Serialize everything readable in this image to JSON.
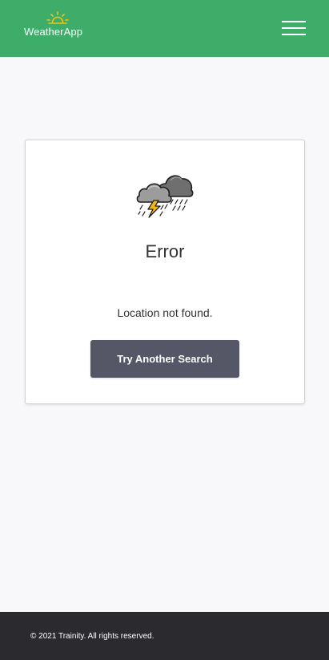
{
  "header": {
    "brand_name": "WeatherApp",
    "brand_icon": "sunrise-icon",
    "menu_icon": "hamburger-menu-icon"
  },
  "error_card": {
    "icon": "thunderstorm-icon",
    "title": "Error",
    "message": "Location not found.",
    "button_label": "Try Another Search"
  },
  "footer": {
    "copyright": "© 2021 Trainity. All rights reserved."
  },
  "colors": {
    "header_bg": "#3ead6a",
    "page_bg": "#f8f8fa",
    "button_bg": "#565766",
    "footer_bg": "#2b2b2f",
    "sun_yellow": "#f1c40f"
  }
}
